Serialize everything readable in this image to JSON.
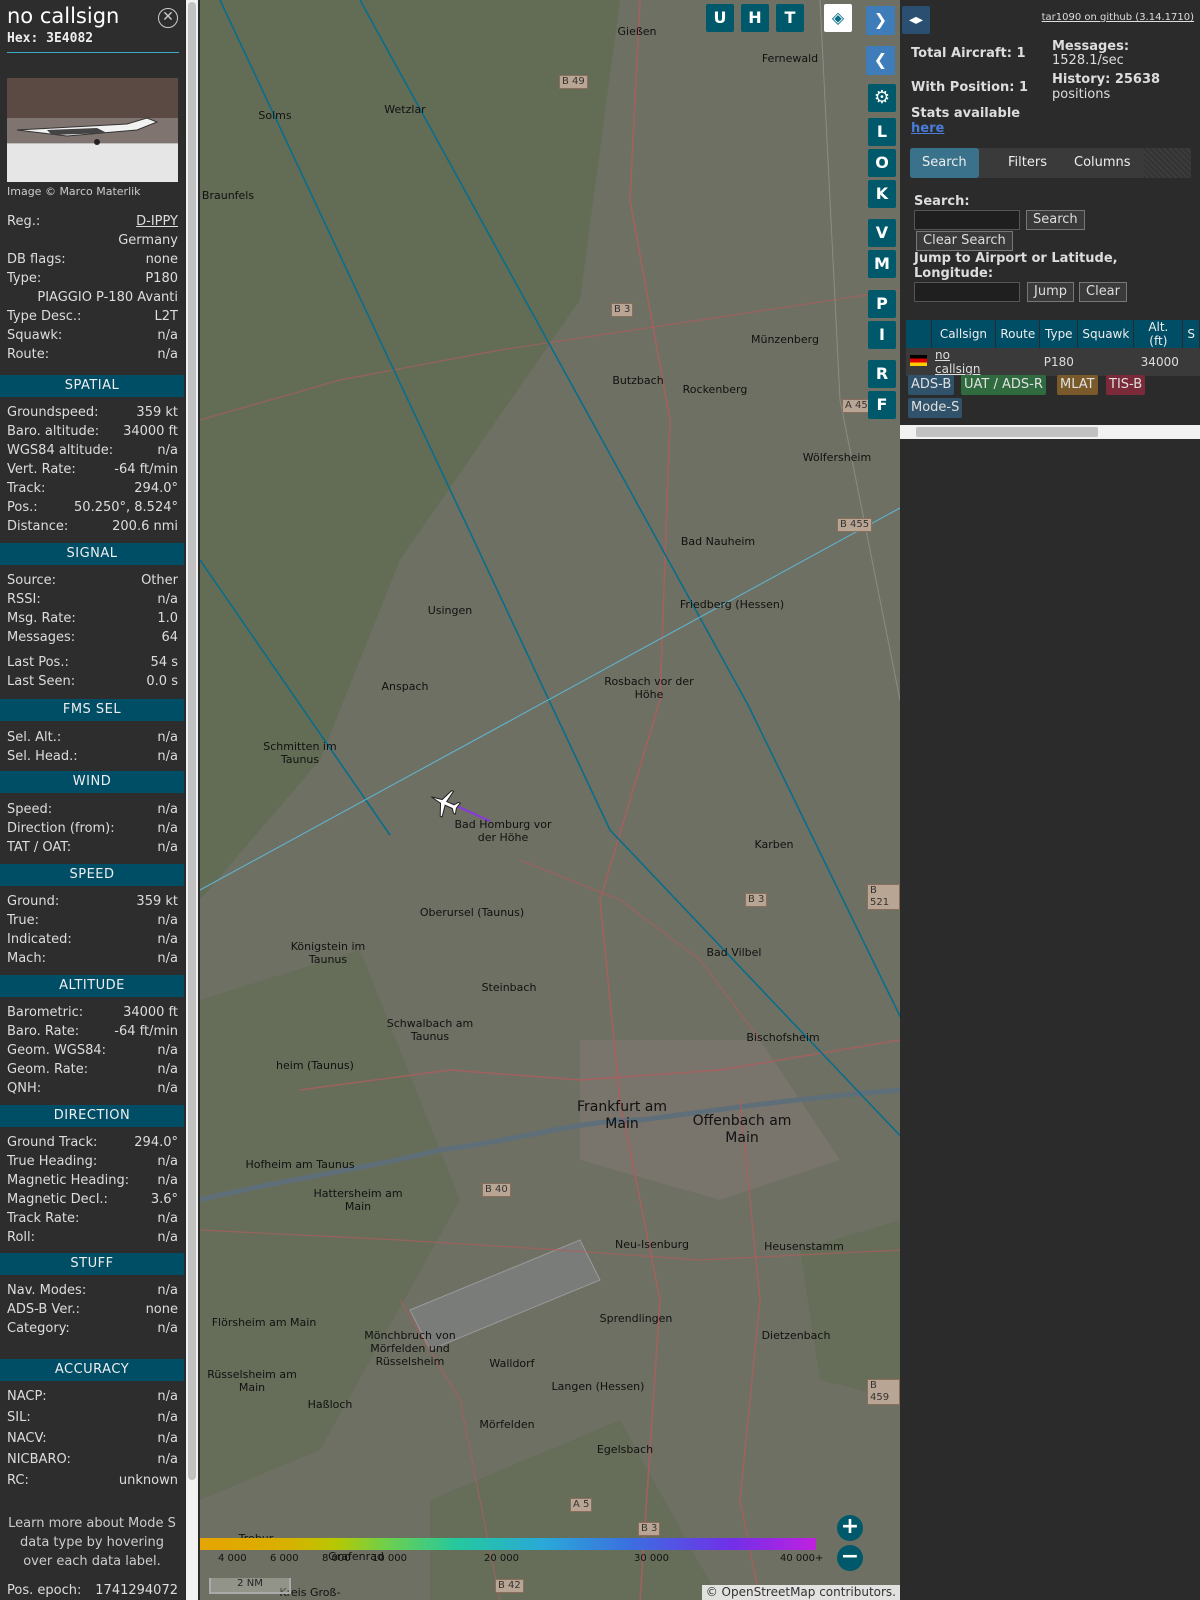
{
  "info": {
    "callsign": "no callsign",
    "hex": "Hex: 3E4082",
    "photo_credit": "Image © Marco Materlik",
    "general": [
      {
        "k": "Reg.:",
        "v": "D-IPPY"
      },
      {
        "k": "",
        "v": "Germany"
      },
      {
        "k": "DB flags:",
        "v": "none"
      },
      {
        "k": "Type:",
        "v": "P180"
      },
      {
        "k": "",
        "v": "PIAGGIO P-180 Avanti"
      },
      {
        "k": "Type Desc.:",
        "v": "L2T"
      },
      {
        "k": "Squawk:",
        "v": "n/a"
      },
      {
        "k": "Route:",
        "v": "n/a"
      }
    ],
    "spatial_title": "SPATIAL",
    "spatial": [
      {
        "k": "Groundspeed:",
        "v": "359 kt"
      },
      {
        "k": "Baro. altitude:",
        "v": "34000 ft"
      },
      {
        "k": "WGS84 altitude:",
        "v": "n/a"
      },
      {
        "k": "Vert. Rate:",
        "v": "-64 ft/min"
      },
      {
        "k": "Track:",
        "v": "294.0°"
      },
      {
        "k": "Pos.:",
        "v": "50.250°, 8.524°"
      },
      {
        "k": "Distance:",
        "v": "200.6 nmi"
      }
    ],
    "signal_title": "SIGNAL",
    "signal": [
      {
        "k": "Source:",
        "v": "Other"
      },
      {
        "k": "RSSI:",
        "v": "n/a"
      },
      {
        "k": "Msg. Rate:",
        "v": "1.0"
      },
      {
        "k": "Messages:",
        "v": "64"
      },
      {
        "k": "Last Pos.:",
        "v": "54 s"
      },
      {
        "k": "Last Seen:",
        "v": "0.0 s"
      }
    ],
    "fms_title": "FMS SEL",
    "fms": [
      {
        "k": "Sel. Alt.:",
        "v": "n/a"
      },
      {
        "k": "Sel. Head.:",
        "v": "n/a"
      }
    ],
    "wind_title": "WIND",
    "wind": [
      {
        "k": "Speed:",
        "v": "n/a"
      },
      {
        "k": "Direction (from):",
        "v": "n/a"
      },
      {
        "k": "TAT / OAT:",
        "v": "n/a"
      }
    ],
    "speed_title": "SPEED",
    "speed": [
      {
        "k": "Ground:",
        "v": "359 kt"
      },
      {
        "k": "True:",
        "v": "n/a"
      },
      {
        "k": "Indicated:",
        "v": "n/a"
      },
      {
        "k": "Mach:",
        "v": "n/a"
      }
    ],
    "altitude_title": "ALTITUDE",
    "altitude": [
      {
        "k": "Barometric:",
        "v": "34000 ft"
      },
      {
        "k": "Baro. Rate:",
        "v": "-64 ft/min"
      },
      {
        "k": "Geom. WGS84:",
        "v": "n/a"
      },
      {
        "k": "Geom. Rate:",
        "v": "n/a"
      },
      {
        "k": "QNH:",
        "v": "n/a"
      }
    ],
    "direction_title": "DIRECTION",
    "direction": [
      {
        "k": "Ground Track:",
        "v": "294.0°"
      },
      {
        "k": "True Heading:",
        "v": "n/a"
      },
      {
        "k": "Magnetic Heading:",
        "v": "n/a"
      },
      {
        "k": "Magnetic Decl.:",
        "v": "3.6°"
      },
      {
        "k": "Track Rate:",
        "v": "n/a"
      },
      {
        "k": "Roll:",
        "v": "n/a"
      }
    ],
    "stuff_title": "STUFF",
    "stuff": [
      {
        "k": "Nav. Modes:",
        "v": "n/a"
      },
      {
        "k": "ADS-B Ver.:",
        "v": "none"
      },
      {
        "k": "Category:",
        "v": "n/a"
      }
    ],
    "accuracy_title": "ACCURACY",
    "accuracy": [
      {
        "k": "NACP:",
        "v": "n/a"
      },
      {
        "k": "SIL:",
        "v": "n/a"
      },
      {
        "k": "NACV:",
        "v": "n/a"
      },
      {
        "k": "NICBARO:",
        "v": "n/a"
      },
      {
        "k": "RC:",
        "v": "unknown"
      }
    ],
    "note": "Learn more about Mode S data type by hovering over each data label.",
    "epoch_label": "Pos. epoch:",
    "epoch_value": "1741294072"
  },
  "map": {
    "buttons_top": [
      "U",
      "H",
      "T"
    ],
    "buttons_side": [
      "L",
      "O",
      "K",
      "V",
      "M",
      "P",
      "I",
      "R",
      "F"
    ],
    "places": [
      "Solms",
      "Wetzlar",
      "Gießen",
      "Braunfels",
      "Fernewald",
      "Butzbach",
      "Rockenberg",
      "Münzenberg",
      "Bad Nauheim",
      "Friedberg (Hessen)",
      "Wölfersheim",
      "Usingen",
      "Anspach",
      "Rosbach vor der Höhe",
      "Schmitten im Taunus",
      "Bad Homburg vor der Höhe",
      "Karben",
      "Oberursel (Taunus)",
      "Königstein im Taunus",
      "Steinbach",
      "Bad Vilbel",
      "Schwalbach am Taunus",
      "Bischofsheim",
      "heim (Taunus)",
      "Frankfurt am Main",
      "Offenbach am Main",
      "Hofheim am Taunus",
      "Hattersheim am Main",
      "Neu-Isenburg",
      "Heusenstamm",
      "Flörsheim am Main",
      "Sprendlingen",
      "Dietzenbach",
      "Walldorf",
      "Rüsselsheim am Main",
      "Haßloch",
      "Langen (Hessen)",
      "Mörfelden",
      "Egelsbach",
      "Mönchbruch von Mörfelden und Rüsselsheim",
      "Kreis Groß-",
      "Grafenrad",
      "Trebur"
    ],
    "roads": [
      "B 49",
      "B 3",
      "B 455",
      "B 3",
      "B 521",
      "B 40",
      "B 459",
      "A 5",
      "B 3",
      "B 42",
      "A 45"
    ],
    "legend_ticks": [
      "4 000",
      "6 000",
      "8 000",
      "10 000",
      "20 000",
      "30 000",
      "40 000+"
    ],
    "scale": "2 NM",
    "attribution": "© OpenStreetMap contributors."
  },
  "panel": {
    "github": "tar1090 on github (3.14.1710)",
    "total_label": "Total Aircraft: 1",
    "pos_label": "With Position: 1",
    "stats_label": "Stats available",
    "stats_link": "here",
    "messages_label": "Messages:",
    "messages_value": "1528.1/sec",
    "history_label": "History: 25638",
    "history_value": "positions",
    "tabs": [
      "Search",
      "Filters",
      "Columns"
    ],
    "search_label": "Search:",
    "search_btn": "Search",
    "clear_search_btn": "Clear Search",
    "jump_label": "Jump to Airport or Latitude, Longitude:",
    "jump_btn": "Jump",
    "clear_btn": "Clear",
    "columns": [
      "",
      "Callsign",
      "Route",
      "Type",
      "Squawk",
      "Alt. (ft)",
      "S"
    ],
    "row": [
      "",
      "no callsign",
      "",
      "P180",
      "",
      "34000",
      ""
    ],
    "badges": [
      "ADS-B",
      "UAT / ADS-R",
      "MLAT",
      "TIS-B",
      "Mode-S"
    ]
  }
}
